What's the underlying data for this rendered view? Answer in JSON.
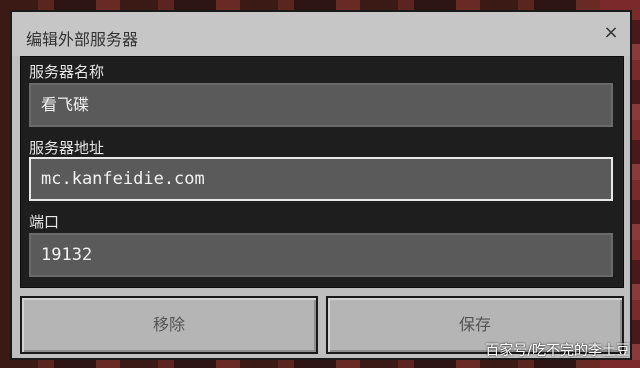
{
  "dialog": {
    "title": "编辑外部服务器",
    "close_icon": "×"
  },
  "fields": {
    "server_name": {
      "label": "服务器名称",
      "value": "看飞碟"
    },
    "server_address": {
      "label": "服务器地址",
      "value": "mc.kanfeidie.com"
    },
    "port": {
      "label": "端口",
      "value": "19132"
    }
  },
  "buttons": {
    "remove": "移除",
    "save": "保存"
  },
  "watermark": "百家号/吃不完的李土豆"
}
